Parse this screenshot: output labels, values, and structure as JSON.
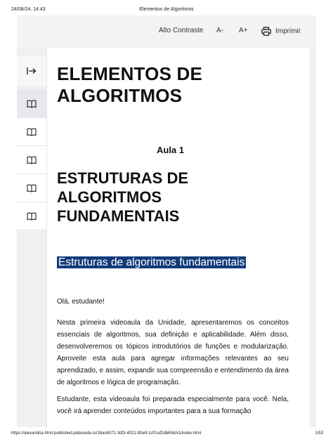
{
  "print_header": {
    "date": "24/08/24, 14:43",
    "title": "Elementos de Algoritmos"
  },
  "toolbar": {
    "contrast_label": "Alto Contraste",
    "decrease_font_label": "A-",
    "increase_font_label": "A+",
    "print_label": "Imprimir"
  },
  "sidebar": {
    "toggle_icon": "collapse-right-arrow-icon",
    "items": [
      {
        "icon": "book-icon",
        "active": true
      },
      {
        "icon": "book-icon",
        "active": false
      },
      {
        "icon": "book-icon",
        "active": false
      },
      {
        "icon": "book-icon",
        "active": false
      },
      {
        "icon": "book-icon",
        "active": false
      }
    ]
  },
  "content": {
    "main_title": "ELEMENTOS DE ALGORITMOS",
    "lesson": "Aula 1",
    "section_title": "ESTRUTURAS DE ALGORITMOS FUNDAMENTAIS",
    "highlight_title": "Estruturas de algoritmos fundamentais",
    "greeting": "Olá, estudante!",
    "paragraph1": "Nesta primeira videoaula da Unidade, apresentaremos os conceitos essenciais de algoritmos, sua definição e aplicabilidade. Além disso, desenvolveremos os tópicos introdutórios de funções e modularização. Aproveite esta aula para agregar informações relevantes ao seu aprendizado, e assim, expandir sua compreensão e entendimento da área de algoritmos e lógica de programação.",
    "paragraph2": "Estudante, esta videoaula foi preparada especialmente para você. Nela, você irá aprender conteúdos importantes para a sua formação"
  },
  "print_footer": {
    "url": "https://alexandria-html-published.platosedu.io/16ac6071-3df3-4021-90e9-1d7caf2db65d/v1/index.html",
    "page": "1/53"
  },
  "colors": {
    "highlight_background": "#123b7a",
    "highlight_text": "#ffffff",
    "toolbar_background": "#f3f3f4",
    "active_sidebar": "#e7e8ee"
  }
}
